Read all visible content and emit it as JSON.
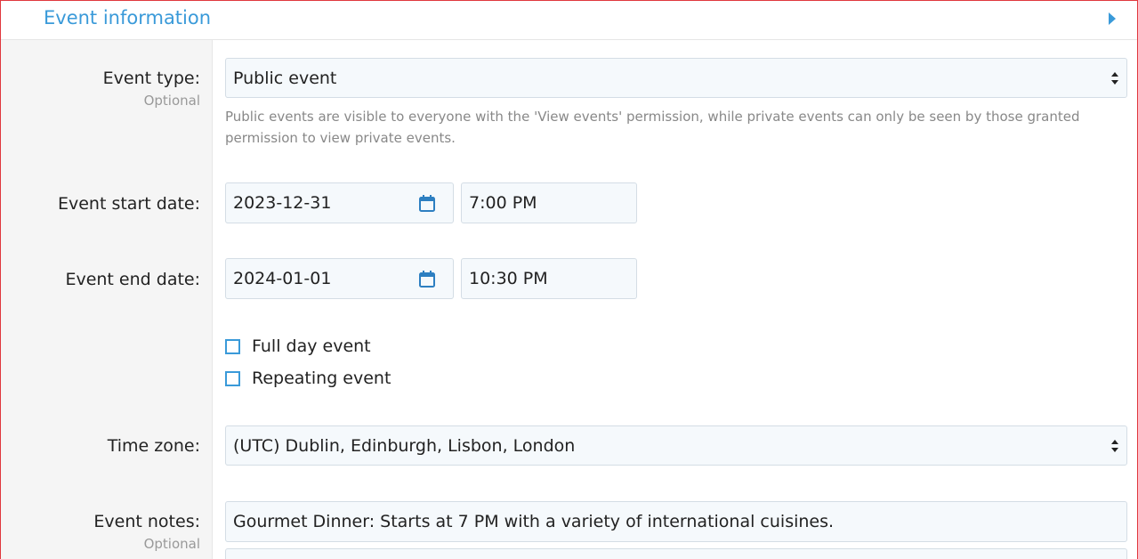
{
  "section": {
    "title": "Event information"
  },
  "event_type": {
    "label": "Event type:",
    "sublabel": "Optional",
    "value": "Public event",
    "help": "Public events are visible to everyone with the 'View events' permission, while private events can only be seen by those granted permission to view private events."
  },
  "start": {
    "label": "Event start date:",
    "date": "2023-12-31",
    "time": "7:00 PM"
  },
  "end": {
    "label": "Event end date:",
    "date": "2024-01-01",
    "time": "10:30 PM"
  },
  "checkboxes": {
    "full_day": "Full day event",
    "repeating": "Repeating event"
  },
  "timezone": {
    "label": "Time zone:",
    "value": "(UTC) Dublin, Edinburgh, Lisbon, London"
  },
  "notes": {
    "label": "Event notes:",
    "sublabel": "Optional",
    "value": "Gourmet Dinner: Starts at 7 PM with a variety of international cuisines."
  },
  "colors": {
    "accent": "#3a9ad9",
    "border": "#e0383e"
  }
}
